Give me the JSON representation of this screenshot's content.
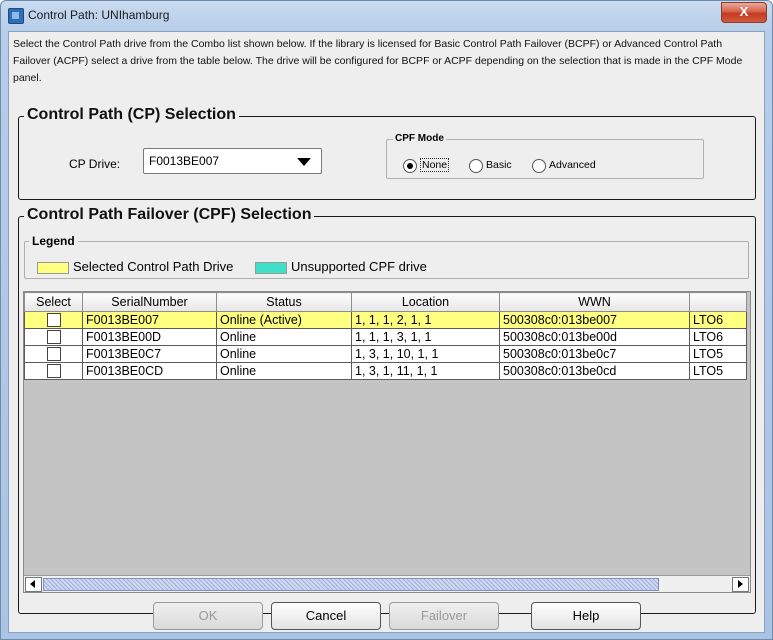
{
  "window": {
    "title": "Control Path: UNIhamburg",
    "close_glyph": "X"
  },
  "intro_text": "Select the Control Path drive from the Combo list shown below. If the library is licensed for Basic Control Path Failover (BCPF) or Advanced Control Path Failover (ACPF) select a drive from the table below. The drive will be configured for BCPF or ACPF depending on the selection that is made in the CPF Mode panel.",
  "cp_selection": {
    "title": "Control Path (CP) Selection",
    "drive_label": "CP Drive:",
    "drive_value": "F0013BE007"
  },
  "cpf_mode": {
    "title": "CPF Mode",
    "options": [
      "None",
      "Basic",
      "Advanced"
    ],
    "selected": "None"
  },
  "cpf_selection": {
    "title": "Control Path Failover (CPF) Selection",
    "legend": {
      "title": "Legend",
      "items": [
        {
          "label": "Selected Control Path Drive",
          "color": "#ffff80"
        },
        {
          "label": "Unsupported CPF drive",
          "color": "#40e0c8"
        }
      ]
    }
  },
  "table": {
    "columns": [
      "Select",
      "SerialNumber",
      "Status",
      "Location",
      "WWN",
      ""
    ],
    "rows": [
      {
        "serial": "F0013BE007",
        "status": "Online (Active)",
        "location": "1, 1, 1, 2, 1, 1",
        "wwn": "500308c0:013be007",
        "type": "LTO6",
        "highlight": true
      },
      {
        "serial": "F0013BE00D",
        "status": "Online",
        "location": "1, 1, 1, 3, 1, 1",
        "wwn": "500308c0:013be00d",
        "type": "LTO6",
        "highlight": false
      },
      {
        "serial": "F0013BE0C7",
        "status": "Online",
        "location": "1, 3, 1, 10, 1, 1",
        "wwn": "500308c0:013be0c7",
        "type": "LTO5",
        "highlight": false
      },
      {
        "serial": "F0013BE0CD",
        "status": "Online",
        "location": "1, 3, 1, 11, 1, 1",
        "wwn": "500308c0:013be0cd",
        "type": "LTO5",
        "highlight": false
      }
    ]
  },
  "buttons": {
    "ok": "OK",
    "cancel": "Cancel",
    "failover": "Failover",
    "help": "Help"
  }
}
